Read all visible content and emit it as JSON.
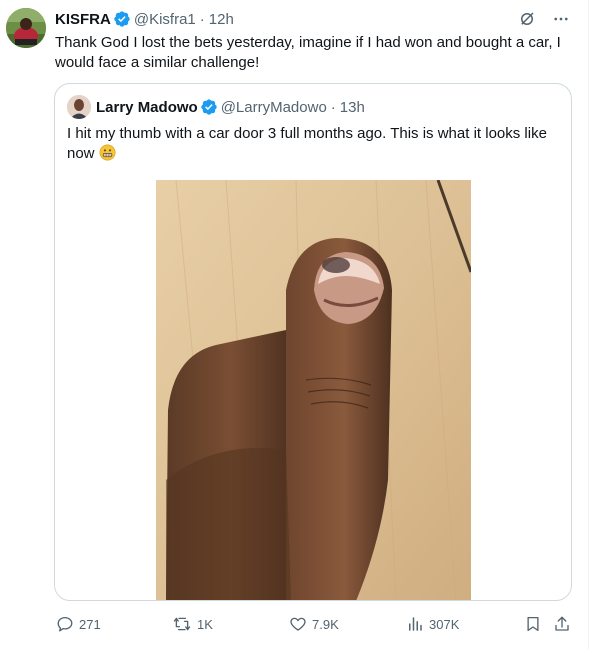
{
  "post": {
    "author_name": "KISFRA",
    "author_handle": "@Kisfra1",
    "separator": "·",
    "time": "12h",
    "text": "Thank God I lost the bets yesterday, imagine if I had won and bought a car, I would face a similar challenge!"
  },
  "quoted_post": {
    "author_name": "Larry Madowo",
    "author_handle": "@LarryMadowo",
    "separator": "·",
    "time": "13h",
    "text": "I hit my thumb with a car door 3 full months ago. This is what it looks like now",
    "emoji": "grimacing-face"
  },
  "actions": {
    "replies": "271",
    "reposts": "1K",
    "likes": "7.9K",
    "views": "307K"
  },
  "icons": [
    "verified-badge-icon",
    "grok-icon",
    "more-icon",
    "reply-icon",
    "repost-icon",
    "like-icon",
    "views-icon",
    "bookmark-icon",
    "share-icon"
  ],
  "colors": {
    "verified": "#1d9bf0",
    "secondary_text": "#536471",
    "border": "#cfd9de"
  }
}
